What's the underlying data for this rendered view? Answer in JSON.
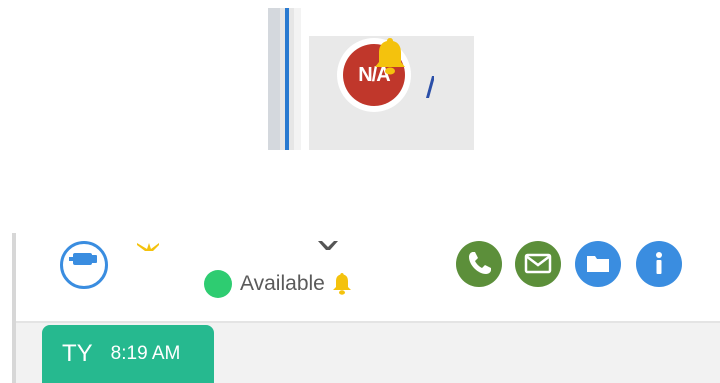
{
  "avatar": {
    "initials": "N/A",
    "bell_icon": "bell-icon"
  },
  "contact_header": {
    "status": {
      "label": "Available",
      "color": "#2ecc71",
      "bell_icon": "bell-icon"
    },
    "pin_icon": "pin-icon",
    "actions": [
      {
        "name": "phone",
        "icon": "phone-icon",
        "color": "#5c8f3a"
      },
      {
        "name": "mail",
        "icon": "mail-icon",
        "color": "#5c8f3a"
      },
      {
        "name": "files",
        "icon": "folder-icon",
        "color": "#3a8de0"
      },
      {
        "name": "info",
        "icon": "info-icon",
        "color": "#3a8de0"
      }
    ]
  },
  "message": {
    "initials": "TY",
    "time": "8:19 AM",
    "color": "#26b98f"
  },
  "colors": {
    "accent_blue": "#3a8de0",
    "avatar_red": "#c0372b",
    "bell_yellow": "#f4c20d"
  }
}
